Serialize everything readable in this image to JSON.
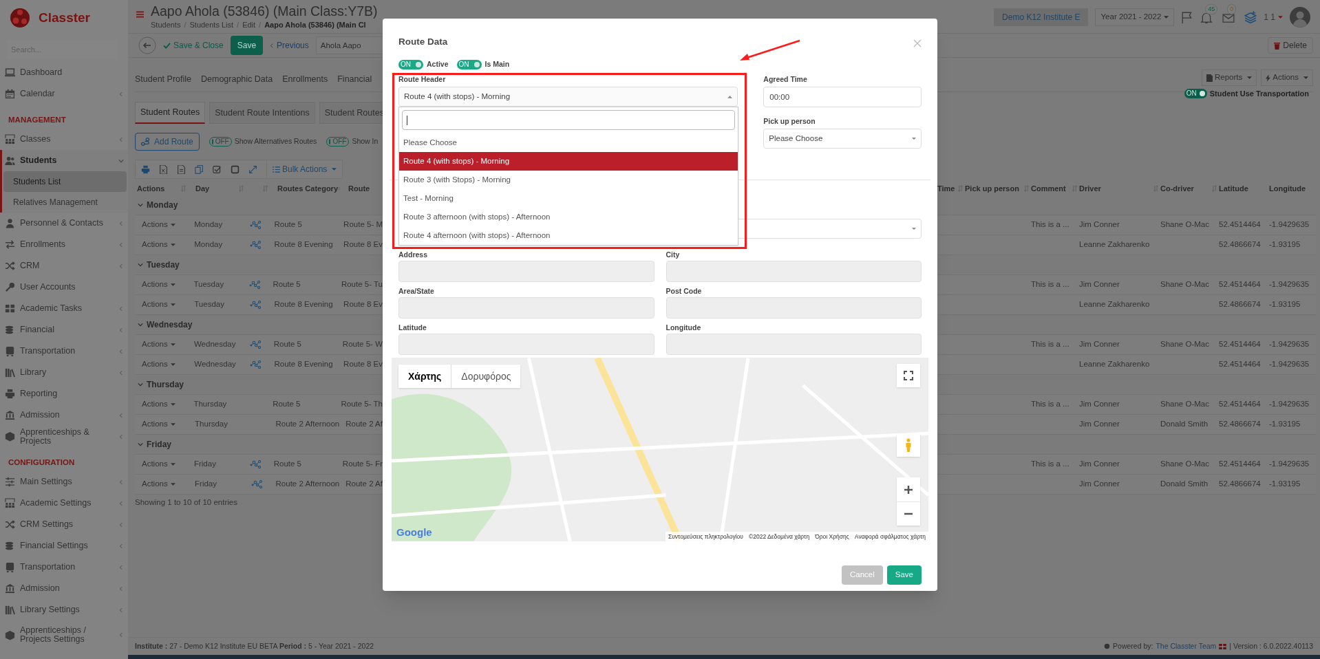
{
  "app": {
    "logo_text": "Classter",
    "search_placeholder": "Search..."
  },
  "sidebar": {
    "items": [
      {
        "kind": "link",
        "label": "Dashboard",
        "selected": false
      },
      {
        "kind": "menu",
        "label": "Calendar",
        "selected": false,
        "expanded": false
      },
      {
        "kind": "section",
        "label": "MANAGEMENT"
      },
      {
        "kind": "menu",
        "label": "Classes",
        "selected": false,
        "expanded": false
      },
      {
        "kind": "menu",
        "label": "Students",
        "selected": true,
        "expanded": true,
        "children": [
          {
            "label": "Students List",
            "selected": true
          },
          {
            "label": "Relatives Management",
            "selected": false
          }
        ]
      },
      {
        "kind": "menu",
        "label": "Personnel & Contacts",
        "selected": false,
        "expanded": false
      },
      {
        "kind": "menu",
        "label": "Enrollments",
        "selected": false,
        "expanded": false
      },
      {
        "kind": "menu",
        "label": "CRM",
        "selected": false,
        "expanded": false
      },
      {
        "kind": "link",
        "label": "User Accounts",
        "selected": false
      },
      {
        "kind": "menu",
        "label": "Academic Tasks",
        "selected": false,
        "expanded": false
      },
      {
        "kind": "menu",
        "label": "Financial",
        "selected": false,
        "expanded": false
      },
      {
        "kind": "menu",
        "label": "Transportation",
        "selected": false,
        "expanded": false
      },
      {
        "kind": "menu",
        "label": "Library",
        "selected": false,
        "expanded": false
      },
      {
        "kind": "link",
        "label": "Reporting",
        "selected": false
      },
      {
        "kind": "menu",
        "label": "Admission",
        "selected": false,
        "expanded": false
      },
      {
        "kind": "menu",
        "label": "Apprenticeships & Projects",
        "selected": false,
        "expanded": false
      },
      {
        "kind": "section",
        "label": "CONFIGURATION"
      },
      {
        "kind": "menu",
        "label": "Main Settings",
        "selected": false,
        "expanded": false
      },
      {
        "kind": "menu",
        "label": "Academic Settings",
        "selected": false,
        "expanded": false
      },
      {
        "kind": "menu",
        "label": "CRM Settings",
        "selected": false,
        "expanded": false
      },
      {
        "kind": "menu",
        "label": "Financial Settings",
        "selected": false,
        "expanded": false
      },
      {
        "kind": "menu",
        "label": "Transportation",
        "selected": false,
        "expanded": false
      },
      {
        "kind": "menu",
        "label": "Admission",
        "selected": false,
        "expanded": false
      },
      {
        "kind": "menu",
        "label": "Library Settings",
        "selected": false,
        "expanded": false
      },
      {
        "kind": "menu",
        "label": "Apprenticeships / Projects Settings",
        "selected": false,
        "expanded": false
      }
    ]
  },
  "header": {
    "title": "Aapo Ahola (53846) (Main Class:Y7B)",
    "breadcrumbs": [
      "Students",
      "Students List",
      "Edit",
      "Aapo Ahola (53846) (Main Cl"
    ],
    "breadcrumb_separators": [
      "/",
      "/",
      "/"
    ],
    "institute": "Demo K12 Institute E",
    "year": "Year 2021 - 2022",
    "notifications": "45",
    "messages": "0",
    "user": "1 1"
  },
  "toolbar": {
    "save_close": "Save & Close",
    "save": "Save",
    "previous": "Previous",
    "student_name": "Ahola Aapo",
    "delete": "Delete"
  },
  "tabs": [
    {
      "label": "Student Profile",
      "selected": false
    },
    {
      "label": "Demographic Data",
      "selected": false
    },
    {
      "label": "Enrollments",
      "selected": false
    },
    {
      "label": "Financial",
      "selected": false
    }
  ],
  "tab_actions": [
    "Reports",
    "Actions"
  ],
  "subtabs": [
    {
      "label": "Student Routes",
      "selected": true
    },
    {
      "label": "Student Route Intentions",
      "selected": false
    },
    {
      "label": "Student Routes",
      "selected": false
    }
  ],
  "add_route": "Add Route",
  "filters": [
    {
      "on": false,
      "text": "OFF",
      "label": "Show Alternatives Routes"
    },
    {
      "on": false,
      "text": "OFF",
      "label": "Show In"
    }
  ],
  "transport_toggle": {
    "on": true,
    "text": "ON",
    "label": "Student Use Transportation"
  },
  "bulk_actions": "Bulk Actions",
  "table": {
    "columns_left": [
      "Actions",
      "Day",
      "Routes Category",
      "Route"
    ],
    "columns_right": [
      "Time",
      "Pick up person",
      "Comment",
      "Driver",
      "Co-driver",
      "Latitude",
      "Longitude"
    ],
    "groups": [
      {
        "day": "Monday",
        "rows": [
          {
            "action": "Actions",
            "day": "Monday",
            "mapped": true,
            "category": "Route 5",
            "route": "Route 5- M",
            "comment": "This is a ...",
            "driver": "Jim Conner",
            "co_driver": "Shane O-Mac",
            "latitude": "52.4514464",
            "longitude": "-1.9429635"
          },
          {
            "action": "Actions",
            "day": "Monday",
            "mapped": true,
            "category": "Route 8 Evening",
            "route": "Route 8 Ev",
            "driver": "Leanne Zakharenko",
            "latitude": "52.4866674",
            "longitude": "-1.93195"
          }
        ]
      },
      {
        "day": "Tuesday",
        "rows": [
          {
            "action": "Actions",
            "day": "Tuesday",
            "mapped": true,
            "category": "Route 5",
            "route": "Route 5- Tu",
            "comment": "This is a ...",
            "driver": "Jim Conner",
            "co_driver": "Shane O-Mac",
            "latitude": "52.4514464",
            "longitude": "-1.9429635"
          },
          {
            "action": "Actions",
            "day": "Tuesday",
            "mapped": true,
            "category": "Route 8 Evening",
            "route": "Route 8 Ev",
            "driver": "Leanne Zakharenko",
            "latitude": "52.4866674",
            "longitude": "-1.93195"
          }
        ]
      },
      {
        "day": "Wednesday",
        "rows": [
          {
            "action": "Actions",
            "day": "Wednesday",
            "mapped": true,
            "category": "Route 5",
            "route": "Route 5- W",
            "comment": "This is a ...",
            "driver": "Jim Conner",
            "co_driver": "Shane O-Mac",
            "latitude": "52.4514464",
            "longitude": "-1.9429635"
          },
          {
            "action": "Actions",
            "day": "Wednesday",
            "mapped": true,
            "category": "Route 8 Evening",
            "route": "Route 8 Ev",
            "driver": "Leanne Zakharenko",
            "latitude": "52.4514464",
            "longitude": "-1.9429635"
          }
        ]
      },
      {
        "day": "Thursday",
        "rows": [
          {
            "action": "Actions",
            "day": "Thursday",
            "mapped": false,
            "category": "Route 5",
            "route": "Route 5- Th",
            "comment": "This is a ...",
            "driver": "Jim Conner",
            "co_driver": "Shane O-Mac",
            "latitude": "52.4514464",
            "longitude": "-1.9429635"
          },
          {
            "action": "Actions",
            "day": "Thursday",
            "mapped": false,
            "category": "Route 2 Afternoon",
            "route": "Route 2 Af",
            "driver": "Jim Conner",
            "co_driver": "Donald Smith",
            "latitude": "52.4866674",
            "longitude": "-1.93195"
          }
        ]
      },
      {
        "day": "Friday",
        "rows": [
          {
            "action": "Actions",
            "day": "Friday",
            "mapped": true,
            "category": "Route 5",
            "route": "Route 5- Fr",
            "comment": "This is a ...",
            "driver": "Jim Conner",
            "co_driver": "Shane O-Mac",
            "latitude": "52.4514464",
            "longitude": "-1.9429635"
          },
          {
            "action": "Actions",
            "day": "Friday",
            "mapped": true,
            "category": "Route 2 Afternoon",
            "route": "Route 2 Af",
            "driver": "Jim Conner",
            "co_driver": "Donald Smith",
            "latitude": "52.4866674",
            "longitude": "-1.93195"
          }
        ]
      }
    ],
    "info": "Showing 1 to 10 of 10 entries"
  },
  "status_bar": {
    "context": "**Institute :** 27 - Demo K12 Institute EU BETA **Period :** 5 - Year 2021 - 2022",
    "powered_by": "Powered by:",
    "team_link": "The Classter Team",
    "version": "| Version : 6.0.2022.40113"
  },
  "modal": {
    "title": "Route Data",
    "toggles": [
      {
        "on": true,
        "text": "ON",
        "label": "Active"
      },
      {
        "on": true,
        "text": "ON",
        "label": "Is Main"
      }
    ],
    "route_header": {
      "label": "Route Header",
      "value": "Route 4 (with stops) - Morning",
      "options": [
        {
          "label": "Please Choose",
          "selected": false
        },
        {
          "label": "Route 4 (with stops) - Morning",
          "selected": true
        },
        {
          "label": "Route 3 (with Stops) - Morning",
          "selected": false
        },
        {
          "label": "Test - Morning",
          "selected": false
        },
        {
          "label": "Route 3 afternoon (with stops) - Afternoon",
          "selected": false
        },
        {
          "label": "Route 4 afternoon (with stops) - Afternoon",
          "selected": false
        }
      ]
    },
    "agreed_time": {
      "label": "Agreed Time",
      "value": "00:00"
    },
    "pickup_person": {
      "label": "Pick up person",
      "value": "Please Choose"
    },
    "fields": [
      {
        "label": "Address",
        "disabled": true
      },
      {
        "label": "City",
        "disabled": true
      },
      {
        "label": "Area/State",
        "disabled": true
      },
      {
        "label": "Post Code",
        "disabled": true
      },
      {
        "label": "Latitude",
        "disabled": true
      },
      {
        "label": "Longitude",
        "disabled": true
      }
    ],
    "map": {
      "types": [
        {
          "label": "Χάρτης",
          "selected": true
        },
        {
          "label": "Δορυφόρος",
          "selected": false
        }
      ],
      "logo": "Google",
      "attribution": [
        "Συντομεύσεις πληκτρολογίου",
        "©2022 Δεδομένα χάρτη",
        "Όροι Χρήσης",
        "Αναφορά σφάλματος χάρτη"
      ]
    },
    "buttons": [
      {
        "kind": "secondary",
        "label": "Cancel"
      },
      {
        "kind": "primary",
        "label": "Save"
      }
    ]
  }
}
